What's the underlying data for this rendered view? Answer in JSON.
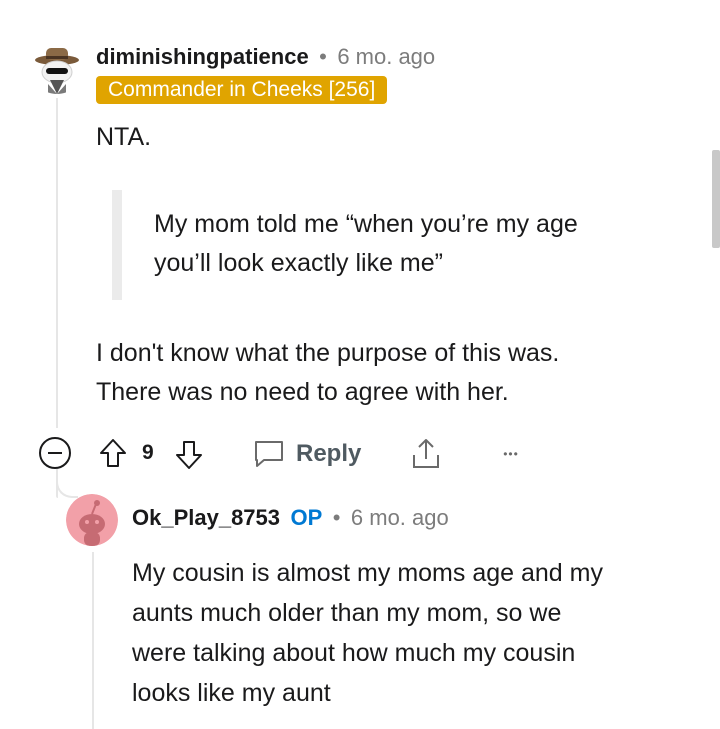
{
  "comment": {
    "username": "diminishingpatience",
    "separator": "•",
    "time": "6 mo. ago",
    "flair": "Commander in Cheeks [256]",
    "verdict": "NTA.",
    "quote_line1": "My mom told me “when you’re my age",
    "quote_line2": "you’ll look exactly like me”",
    "body_line1": "I don't know what the purpose of this was.",
    "body_line2": "There was no need to agree with her.",
    "score": "9",
    "reply_label": "Reply",
    "more_label": "•••",
    "flair_color": "#e0a400"
  },
  "reply": {
    "username": "Ok_Play_8753",
    "op_badge": "OP",
    "separator": "•",
    "time": "6 mo. ago",
    "line1": "My cousin is almost my moms age and my",
    "line2": "aunts much older than my mom, so we",
    "line3": "were talking about how much my cousin",
    "line4": "looks like my aunt",
    "op_color": "#0079d3"
  }
}
